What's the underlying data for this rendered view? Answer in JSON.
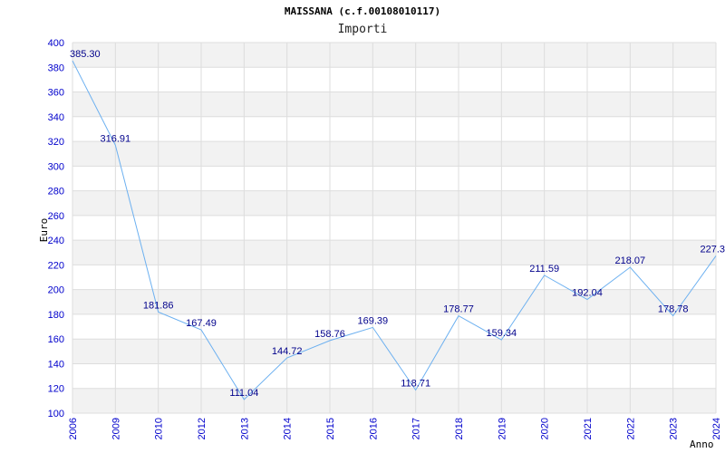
{
  "title": "MAISSANA (c.f.00108010117)",
  "subtitle": "Importi",
  "colors": {
    "line": "#6cb0f0",
    "axis_text": "#0000cc",
    "label_text": "#00008b",
    "band": "#f2f2f2",
    "grid": "#dddddd"
  },
  "chart_data": {
    "type": "line",
    "title": "MAISSANA (c.f.00108010117)",
    "subtitle": "Importi",
    "xlabel": "Anno",
    "ylabel": "Euro",
    "ylim": [
      100,
      400
    ],
    "yticks": [
      "100",
      "120",
      "140",
      "160",
      "180",
      "200",
      "220",
      "240",
      "260",
      "280",
      "300",
      "320",
      "340",
      "360",
      "380",
      "400"
    ],
    "categories": [
      "2006",
      "2009",
      "2010",
      "2012",
      "2013",
      "2014",
      "2015",
      "2016",
      "2017",
      "2018",
      "2019",
      "2020",
      "2021",
      "2022",
      "2023",
      "2024"
    ],
    "series": [
      {
        "values": [
          385.3,
          316.91,
          181.86,
          167.49,
          111.04,
          144.72,
          158.76,
          169.39,
          118.71,
          178.77,
          159.34,
          211.59,
          192.04,
          218.07,
          178.78,
          227.3
        ],
        "labels": [
          "385.30",
          "316.91",
          "181.86",
          "167.49",
          "111.04",
          "144.72",
          "158.76",
          "169.39",
          "118.71",
          "178.77",
          "159.34",
          "211.59",
          "192.04",
          "218.07",
          "178.78",
          "227.3"
        ]
      }
    ],
    "grid": true
  }
}
